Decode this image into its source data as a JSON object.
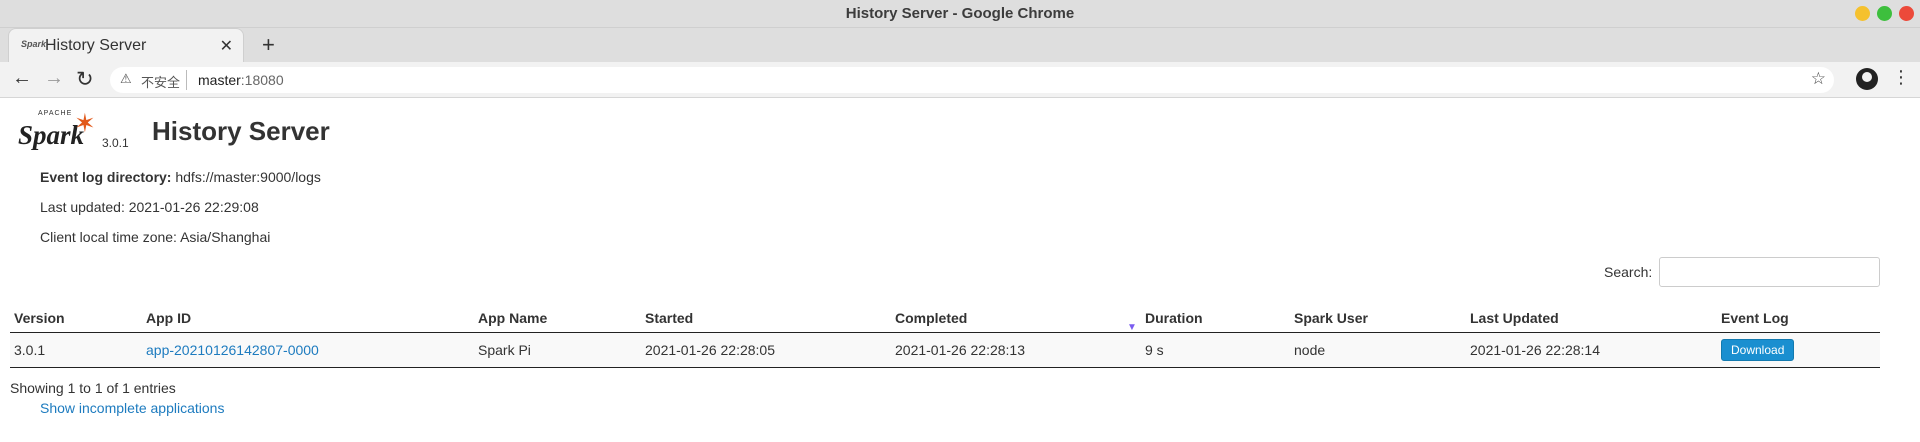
{
  "window": {
    "title": "History Server - Google Chrome"
  },
  "tab": {
    "title": "History Server",
    "favicon": "spark-favicon"
  },
  "address": {
    "insecure_label": "不安全",
    "host": "master",
    "port": ":18080"
  },
  "logo": {
    "apache": "APACHE",
    "spark": "Spark",
    "version": "3.0.1"
  },
  "page": {
    "title": "History Server"
  },
  "info": {
    "event_log_label": "Event log directory:",
    "event_log_value": " hdfs://master:9000/logs",
    "last_updated": "Last updated: 2021-01-26 22:29:08",
    "timezone": "Client local time zone: Asia/Shanghai"
  },
  "search": {
    "label": "Search:",
    "value": ""
  },
  "table": {
    "headers": [
      "Version",
      "App ID",
      "App Name",
      "Started",
      "Completed",
      "Duration",
      "Spark User",
      "Last Updated",
      "Event Log"
    ],
    "rows": [
      {
        "version": "3.0.1",
        "app_id": "app-20210126142807-0000",
        "app_name": "Spark Pi",
        "started": "2021-01-26 22:28:05",
        "completed": "2021-01-26 22:28:13",
        "duration": "9 s",
        "user": "node",
        "last_updated": "2021-01-26 22:28:14",
        "event_log": "Download"
      }
    ]
  },
  "footer": {
    "entries": "Showing 1 to 1 of 1 entries",
    "incomplete_link": "Show incomplete applications"
  },
  "colors": {
    "link": "#1d7bbf",
    "button": "#1a8fd0",
    "spark_orange": "#e25a1c",
    "sort_arrow": "#7a5cf0"
  }
}
